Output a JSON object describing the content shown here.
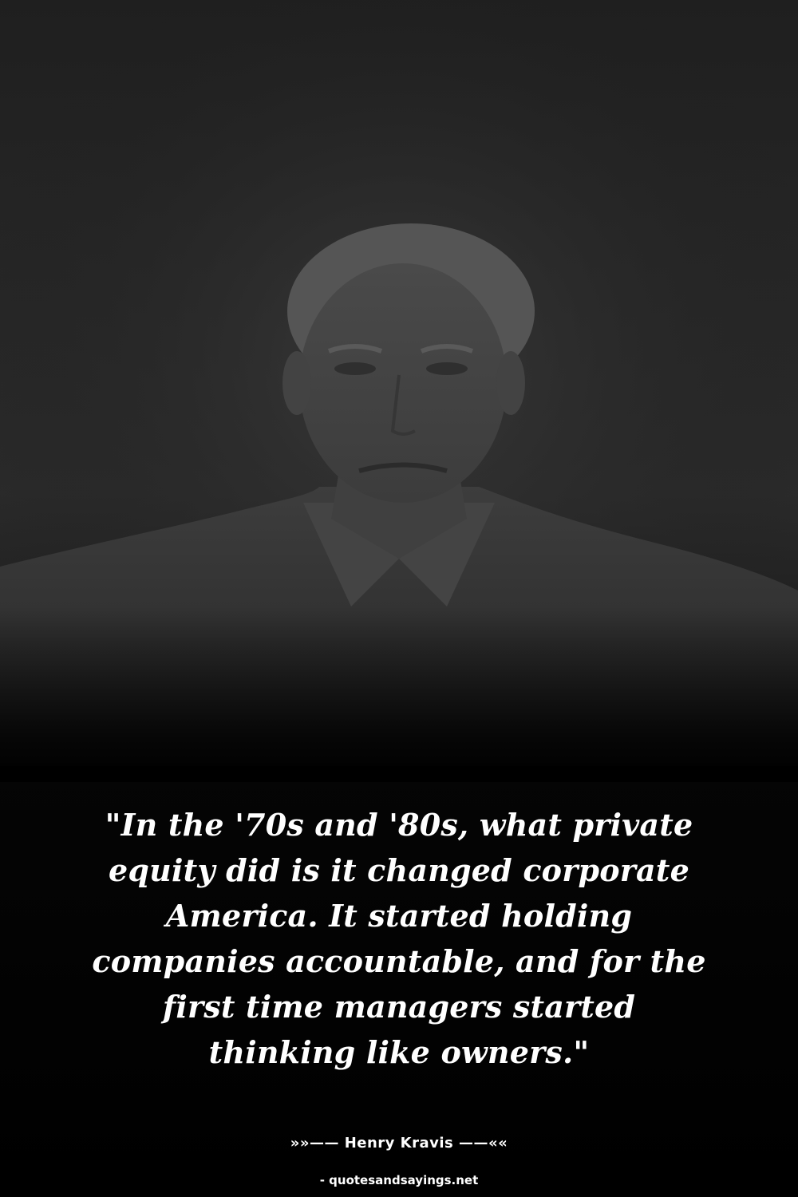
{
  "quote": {
    "text": "\"In the '70s and '80s, what private equity did is it changed corporate America. It started holding companies accountable, and for the first time managers started thinking like owners.\""
  },
  "attribution": {
    "text": "»»—— Henry Kravis ——««"
  },
  "source": {
    "text": "- quotesandsayings.net"
  },
  "colors": {
    "text": "#ffffff",
    "background": "#000000"
  }
}
